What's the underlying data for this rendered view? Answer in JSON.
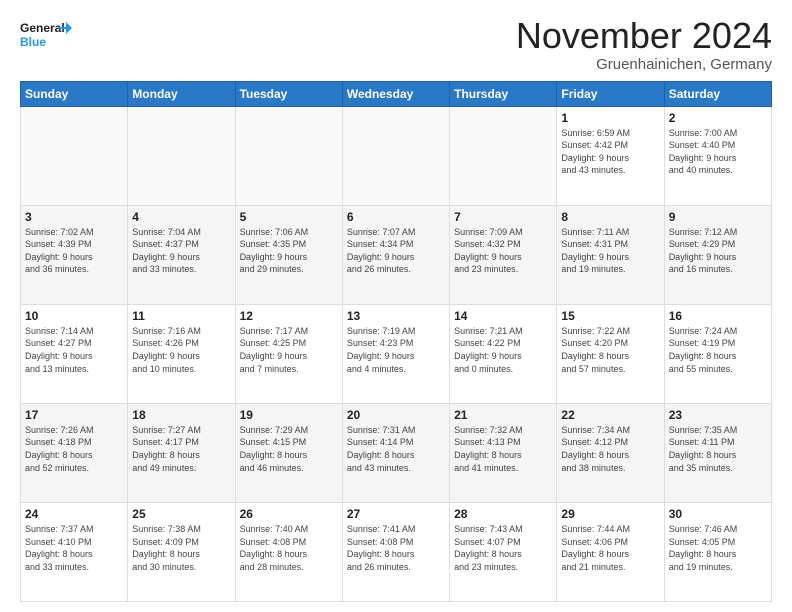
{
  "header": {
    "logo_general": "General",
    "logo_blue": "Blue",
    "month_title": "November 2024",
    "location": "Gruenhainichen, Germany"
  },
  "weekdays": [
    "Sunday",
    "Monday",
    "Tuesday",
    "Wednesday",
    "Thursday",
    "Friday",
    "Saturday"
  ],
  "weeks": [
    [
      {
        "day": "",
        "info": ""
      },
      {
        "day": "",
        "info": ""
      },
      {
        "day": "",
        "info": ""
      },
      {
        "day": "",
        "info": ""
      },
      {
        "day": "",
        "info": ""
      },
      {
        "day": "1",
        "info": "Sunrise: 6:59 AM\nSunset: 4:42 PM\nDaylight: 9 hours\nand 43 minutes."
      },
      {
        "day": "2",
        "info": "Sunrise: 7:00 AM\nSunset: 4:40 PM\nDaylight: 9 hours\nand 40 minutes."
      }
    ],
    [
      {
        "day": "3",
        "info": "Sunrise: 7:02 AM\nSunset: 4:39 PM\nDaylight: 9 hours\nand 36 minutes."
      },
      {
        "day": "4",
        "info": "Sunrise: 7:04 AM\nSunset: 4:37 PM\nDaylight: 9 hours\nand 33 minutes."
      },
      {
        "day": "5",
        "info": "Sunrise: 7:06 AM\nSunset: 4:35 PM\nDaylight: 9 hours\nand 29 minutes."
      },
      {
        "day": "6",
        "info": "Sunrise: 7:07 AM\nSunset: 4:34 PM\nDaylight: 9 hours\nand 26 minutes."
      },
      {
        "day": "7",
        "info": "Sunrise: 7:09 AM\nSunset: 4:32 PM\nDaylight: 9 hours\nand 23 minutes."
      },
      {
        "day": "8",
        "info": "Sunrise: 7:11 AM\nSunset: 4:31 PM\nDaylight: 9 hours\nand 19 minutes."
      },
      {
        "day": "9",
        "info": "Sunrise: 7:12 AM\nSunset: 4:29 PM\nDaylight: 9 hours\nand 16 minutes."
      }
    ],
    [
      {
        "day": "10",
        "info": "Sunrise: 7:14 AM\nSunset: 4:27 PM\nDaylight: 9 hours\nand 13 minutes."
      },
      {
        "day": "11",
        "info": "Sunrise: 7:16 AM\nSunset: 4:26 PM\nDaylight: 9 hours\nand 10 minutes."
      },
      {
        "day": "12",
        "info": "Sunrise: 7:17 AM\nSunset: 4:25 PM\nDaylight: 9 hours\nand 7 minutes."
      },
      {
        "day": "13",
        "info": "Sunrise: 7:19 AM\nSunset: 4:23 PM\nDaylight: 9 hours\nand 4 minutes."
      },
      {
        "day": "14",
        "info": "Sunrise: 7:21 AM\nSunset: 4:22 PM\nDaylight: 9 hours\nand 0 minutes."
      },
      {
        "day": "15",
        "info": "Sunrise: 7:22 AM\nSunset: 4:20 PM\nDaylight: 8 hours\nand 57 minutes."
      },
      {
        "day": "16",
        "info": "Sunrise: 7:24 AM\nSunset: 4:19 PM\nDaylight: 8 hours\nand 55 minutes."
      }
    ],
    [
      {
        "day": "17",
        "info": "Sunrise: 7:26 AM\nSunset: 4:18 PM\nDaylight: 8 hours\nand 52 minutes."
      },
      {
        "day": "18",
        "info": "Sunrise: 7:27 AM\nSunset: 4:17 PM\nDaylight: 8 hours\nand 49 minutes."
      },
      {
        "day": "19",
        "info": "Sunrise: 7:29 AM\nSunset: 4:15 PM\nDaylight: 8 hours\nand 46 minutes."
      },
      {
        "day": "20",
        "info": "Sunrise: 7:31 AM\nSunset: 4:14 PM\nDaylight: 8 hours\nand 43 minutes."
      },
      {
        "day": "21",
        "info": "Sunrise: 7:32 AM\nSunset: 4:13 PM\nDaylight: 8 hours\nand 41 minutes."
      },
      {
        "day": "22",
        "info": "Sunrise: 7:34 AM\nSunset: 4:12 PM\nDaylight: 8 hours\nand 38 minutes."
      },
      {
        "day": "23",
        "info": "Sunrise: 7:35 AM\nSunset: 4:11 PM\nDaylight: 8 hours\nand 35 minutes."
      }
    ],
    [
      {
        "day": "24",
        "info": "Sunrise: 7:37 AM\nSunset: 4:10 PM\nDaylight: 8 hours\nand 33 minutes."
      },
      {
        "day": "25",
        "info": "Sunrise: 7:38 AM\nSunset: 4:09 PM\nDaylight: 8 hours\nand 30 minutes."
      },
      {
        "day": "26",
        "info": "Sunrise: 7:40 AM\nSunset: 4:08 PM\nDaylight: 8 hours\nand 28 minutes."
      },
      {
        "day": "27",
        "info": "Sunrise: 7:41 AM\nSunset: 4:08 PM\nDaylight: 8 hours\nand 26 minutes."
      },
      {
        "day": "28",
        "info": "Sunrise: 7:43 AM\nSunset: 4:07 PM\nDaylight: 8 hours\nand 23 minutes."
      },
      {
        "day": "29",
        "info": "Sunrise: 7:44 AM\nSunset: 4:06 PM\nDaylight: 8 hours\nand 21 minutes."
      },
      {
        "day": "30",
        "info": "Sunrise: 7:46 AM\nSunset: 4:05 PM\nDaylight: 8 hours\nand 19 minutes."
      }
    ]
  ]
}
